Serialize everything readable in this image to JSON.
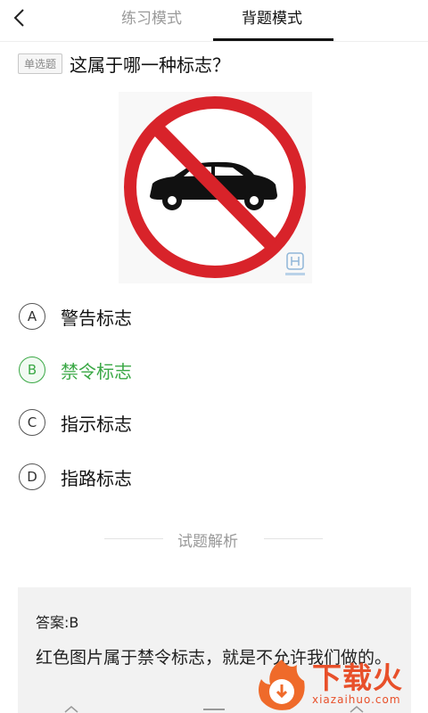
{
  "tabs": {
    "practice": "练习模式",
    "recite": "背题模式"
  },
  "question": {
    "type_tag": "单选题",
    "text": "这属于哪一种标志？"
  },
  "options": [
    {
      "letter": "A",
      "text": "警告标志"
    },
    {
      "letter": "B",
      "text": "禁令标志"
    },
    {
      "letter": "C",
      "text": "指示标志"
    },
    {
      "letter": "D",
      "text": "指路标志"
    }
  ],
  "selected_option": "B",
  "analysis": {
    "title": "试题解析",
    "answer": "答案:B",
    "explanation": "红色图片属于禁令标志，就是不允许我们做的。"
  },
  "watermark": {
    "brand": "下载火",
    "url": "xiazaihuo.com"
  },
  "colors": {
    "correct": "#3aa845",
    "sign_red": "#d8232a",
    "brand": "#e8502a"
  }
}
